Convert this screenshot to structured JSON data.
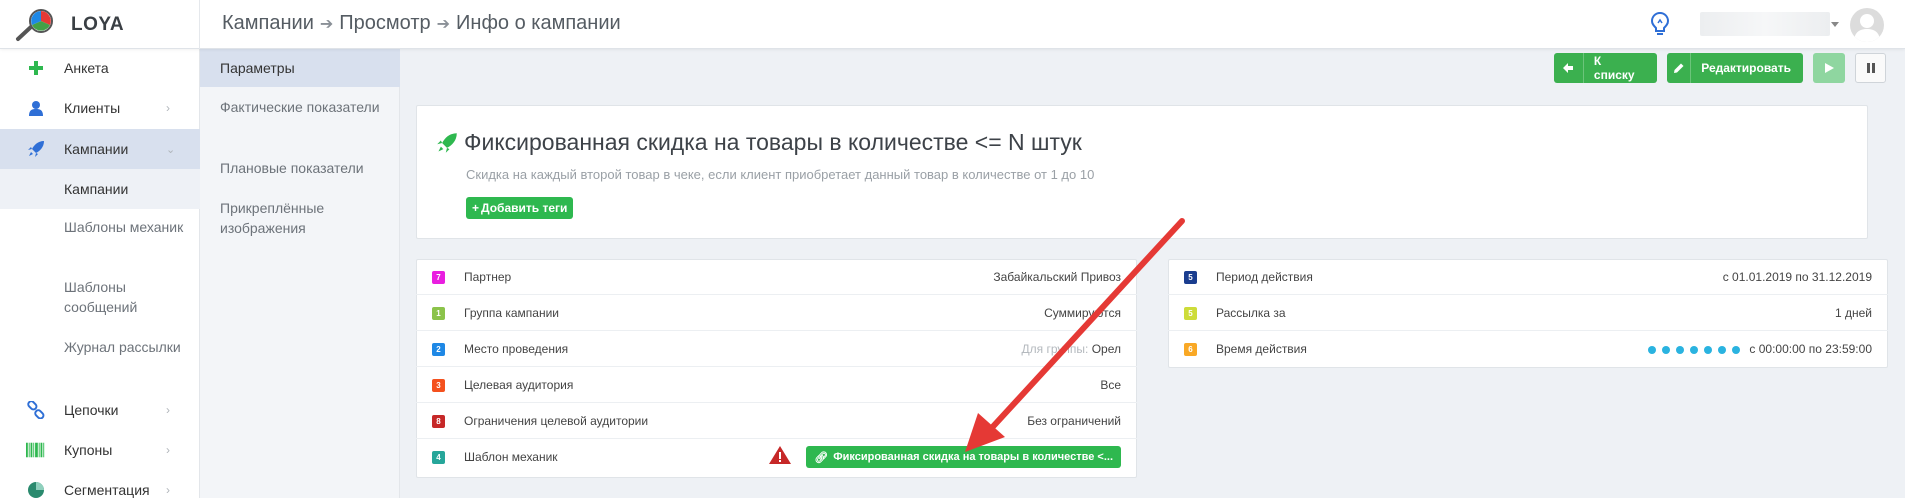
{
  "app": {
    "logo_text": "LOYA"
  },
  "breadcrumb": [
    "Кампании",
    "Просмотр",
    "Инфо о кампании"
  ],
  "sidebar": {
    "items": [
      {
        "label": "Анкета",
        "icon": "plus-icon"
      },
      {
        "label": "Клиенты",
        "icon": "user-icon"
      },
      {
        "label": "Кампании",
        "icon": "rocket-icon"
      },
      {
        "label": "Цепочки",
        "icon": "chain-icon"
      },
      {
        "label": "Купоны",
        "icon": "barcode-icon"
      },
      {
        "label": "Сегментация",
        "icon": "pie-icon"
      }
    ],
    "sub_items": [
      "Кампании",
      "Шаблоны механик",
      "Шаблоны сообщений",
      "Журнал рассылки"
    ]
  },
  "subnav": [
    "Параметры",
    "Фактические показатели",
    "Плановые показатели",
    "Прикреплённые изображения"
  ],
  "toolbar": {
    "back_label": "К списку",
    "edit_label": "Редактировать"
  },
  "campaign": {
    "title": "Фиксированная скидка на товары в количестве <= N штук",
    "description": "Скидка на каждый второй товар в чеке, если клиент приобретает данный товар в количестве от 1 до 10",
    "add_tags_label": "Добавить теги"
  },
  "left_params": [
    {
      "num": "7",
      "color": "#e91ee0",
      "label": "Партнер",
      "value": "Забайкальский Привоз"
    },
    {
      "num": "1",
      "color": "#8bc34a",
      "label": "Группа кампании",
      "value": "Суммируются"
    },
    {
      "num": "2",
      "color": "#1e88e5",
      "label": "Место проведения",
      "muted": "Для группы:",
      "value": "Орел"
    },
    {
      "num": "3",
      "color": "#f4511e",
      "label": "Целевая аудитория",
      "value": "Все"
    },
    {
      "num": "8",
      "color": "#c62828",
      "label": "Ограничения целевой аудитории",
      "value": "Без ограничений"
    },
    {
      "num": "4",
      "color": "#26a69a",
      "label": "Шаблон механик",
      "value": "Фиксированная скидка на товары в количестве <..."
    }
  ],
  "right_params": [
    {
      "num": "5",
      "color": "#1a3d8f",
      "label": "Период действия",
      "value": "с 01.01.2019 по 31.12.2019"
    },
    {
      "num": "5",
      "color": "#cddc39",
      "label": "Рассылка за",
      "value": "1 дней"
    },
    {
      "num": "6",
      "color": "#f9a825",
      "label": "Время действия",
      "value": "с 00:00:00 по 23:59:00"
    }
  ]
}
